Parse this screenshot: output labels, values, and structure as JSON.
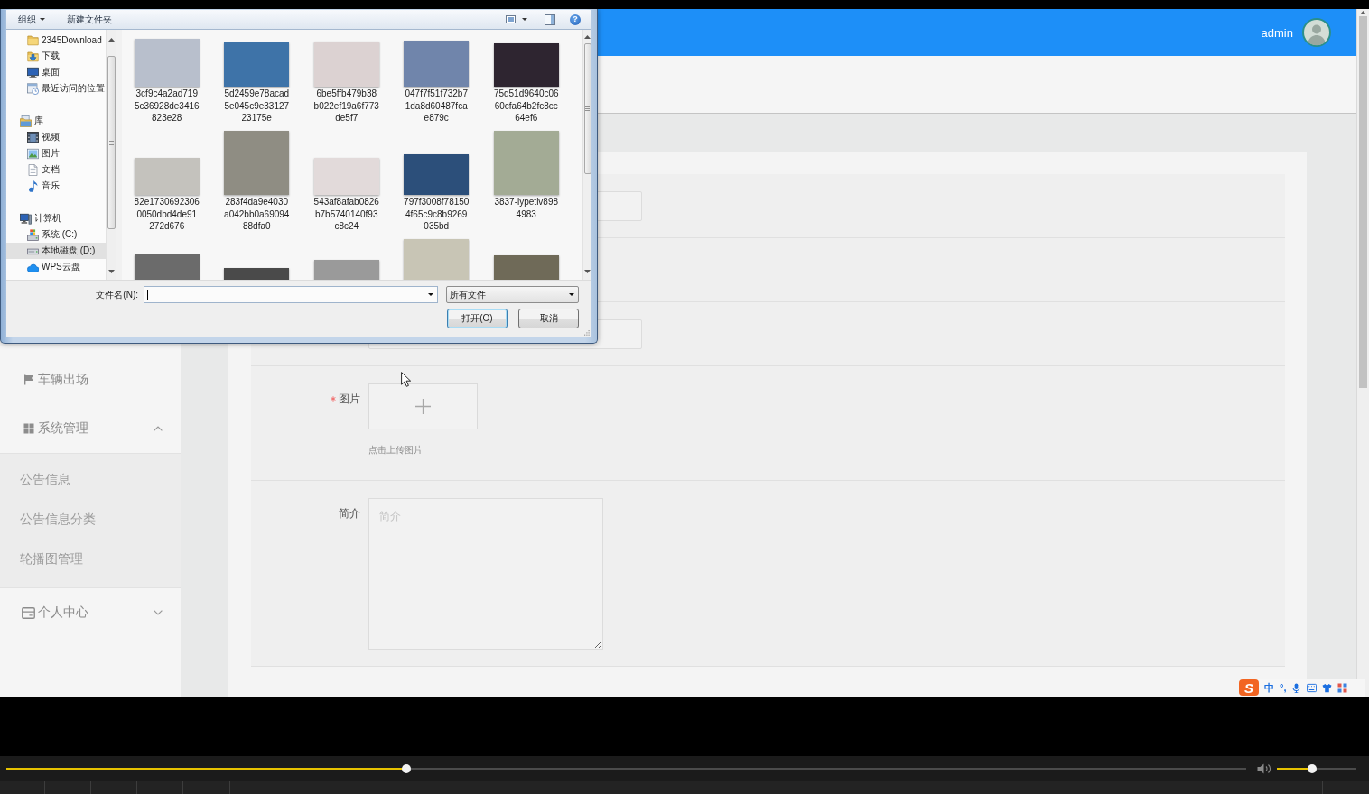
{
  "dialog": {
    "toolbar": {
      "organize": "组织",
      "new_folder": "新建文件夹",
      "help": "?"
    },
    "nav_tree": [
      {
        "children": [
          {
            "label": "2345Download",
            "selected": false
          },
          {
            "label": "下载",
            "selected": false
          },
          {
            "label": "桌面",
            "selected": false
          },
          {
            "label": "最近访问的位置",
            "selected": false
          }
        ]
      },
      {
        "label": "库",
        "selected": false,
        "children": [
          {
            "label": "视频",
            "selected": false
          },
          {
            "label": "图片",
            "selected": false
          },
          {
            "label": "文档",
            "selected": false
          },
          {
            "label": "音乐",
            "selected": false
          }
        ]
      },
      {
        "label": "计算机",
        "selected": false,
        "children": [
          {
            "label": "系统 (C:)",
            "selected": false
          },
          {
            "label": "本地磁盘 (D:)",
            "selected": true
          },
          {
            "label": "WPS云盘",
            "selected": false
          }
        ]
      }
    ],
    "files": [
      {
        "name": "3cf9c4a2ad719\n5c36928de3416\n823e28",
        "thumbnail": true
      },
      {
        "name": "5d2459e78acad\n5e045c9e33127\n23175e",
        "thumbnail": true
      },
      {
        "name": "6be5ffb479b38\nb022ef19a6f773\nde5f7",
        "thumbnail": true
      },
      {
        "name": "047f7f51f732b7\n1da8d60487fca\ne879c",
        "thumbnail": true
      },
      {
        "name": "75d51d9640c06\n60cfa64b2fc8cc\n64ef6",
        "thumbnail": true
      },
      {
        "name": "82e1730692306\n0050dbd4de91\n272d676",
        "thumbnail": true
      },
      {
        "name": "283f4da9e4030\na042bb0a69094\n88dfa0",
        "thumbnail": true
      },
      {
        "name": "543af8afab0826\nb7b5740140f93\nc8c24",
        "thumbnail": true
      },
      {
        "name": "797f3008f78150\n4f65c9c8b9269\n035bd",
        "thumbnail": true
      },
      {
        "name": "3837-iypetiv898\n4983",
        "thumbnail": true
      },
      {
        "thumbnail": true
      },
      {
        "thumbnail": true
      },
      {
        "thumbnail": true
      },
      {
        "thumbnail": true
      },
      {
        "thumbnail": true
      }
    ],
    "file_name": {
      "label": "文件名(N):"
    },
    "file_type": "所有文件",
    "buttons": [
      {
        "label": "打开(O)",
        "default": true
      },
      {
        "label": "取消",
        "default": false
      }
    ]
  },
  "header": {
    "user": "admin"
  },
  "sidebar": {
    "items": [
      {
        "label": "车辆出场",
        "kind": "link"
      },
      {
        "label": "系统管理",
        "kind": "group",
        "expanded": true,
        "children": [
          {
            "label": "公告信息"
          },
          {
            "label": "公告信息分类"
          },
          {
            "label": "轮播图管理"
          }
        ]
      },
      {
        "label": "个人中心",
        "kind": "group",
        "expanded": false
      }
    ]
  },
  "form": {
    "fields": [
      {
        "kind": "input"
      },
      {
        "kind": "empty"
      },
      {
        "kind": "input"
      },
      {
        "kind": "upload",
        "label": "图片",
        "required": true,
        "hint": "点击上传图片"
      },
      {
        "kind": "textarea",
        "label": "简介",
        "required": false,
        "placeholder": "简介"
      }
    ]
  },
  "ime": {
    "logo": "S",
    "mode": "中",
    "punctuation": "°,"
  },
  "player": {
    "progress": {
      "level": 0.323
    },
    "volume": {
      "level": 0.44
    }
  }
}
